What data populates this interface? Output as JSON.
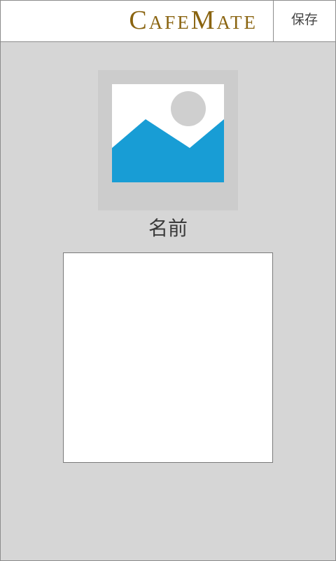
{
  "header": {
    "app_title": "CafeMate",
    "save_label": "保存"
  },
  "profile": {
    "avatar_icon": "image-placeholder-icon",
    "name": "名前"
  },
  "colors": {
    "title": "#8a6410",
    "background": "#d6d6d6",
    "image_sky": "#ffffff",
    "image_mountain": "#189dd5",
    "image_sun": "#cfcfcf"
  }
}
